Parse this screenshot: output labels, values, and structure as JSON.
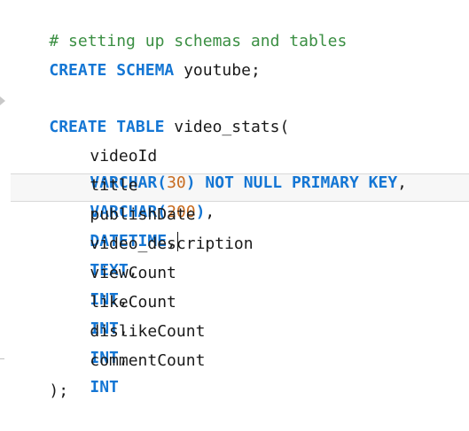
{
  "editor": {
    "lines": [
      {
        "comment": "# setting up schemas and tables"
      },
      {
        "kw": "CREATE SCHEMA",
        "text": " youtube;"
      },
      {
        "kw": "CREATE TABLE",
        "text": " video_stats("
      },
      {
        "field": "videoId",
        "type": "VARCHAR(",
        "num": "30",
        "type_close": ")",
        "constraint": " NOT NULL PRIMARY KEY",
        "punct": ","
      },
      {
        "field": "title",
        "type": "VARCHAR(",
        "num": "200",
        "type_close": ")",
        "punct": ","
      },
      {
        "field": "publishDate",
        "type": "DATETIME",
        "punct": ","
      },
      {
        "field": "video_description",
        "type": "TEXT",
        "punct": ","
      },
      {
        "field": "viewCount",
        "type": "INT",
        "punct": ","
      },
      {
        "field": "likeCount",
        "type": "INT",
        "punct": ","
      },
      {
        "field": "dislikeCount",
        "type": "INT",
        "punct": ","
      },
      {
        "field": "commentCount",
        "type": "INT"
      },
      {
        "text": ");"
      }
    ]
  },
  "colors": {
    "comment": "#3b8f43",
    "keyword": "#1476d4",
    "number": "#c86c21",
    "text": "#1a1a1a",
    "current_line": "#f7f7f7"
  }
}
